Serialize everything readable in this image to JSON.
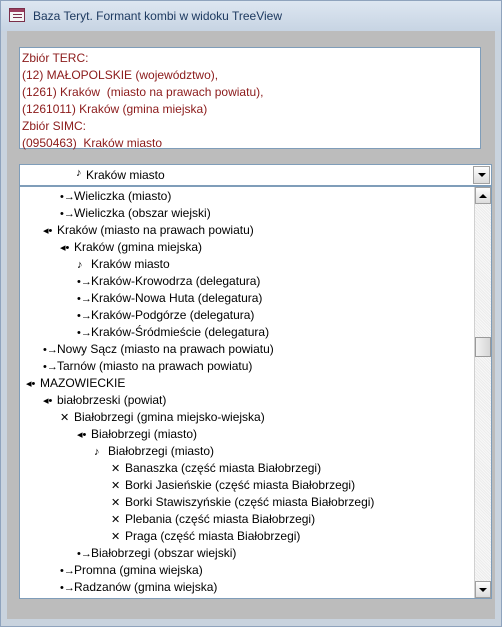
{
  "window": {
    "title": "Baza Teryt. Formant kombi w widoku TreeView"
  },
  "info": {
    "lines": [
      "Zbiór TERC:",
      "(12) MAŁOPOLSKIE (województwo),",
      "(1261) Kraków  (miasto na prawach powiatu),",
      "(1261011) Kraków (gmina miejska)",
      "Zbiór SIMC:",
      "(0950463)  Kraków miasto"
    ]
  },
  "combo": {
    "selected": "Kraków miasto"
  },
  "tree": {
    "glyphs": {
      "expanded": "◂•",
      "collapsed": "•→",
      "leaf": "✕",
      "selected": "♪"
    },
    "nodes": [
      {
        "label": "Wieliczka (miasto)",
        "glyph": "•→",
        "level": 2
      },
      {
        "label": "Wieliczka (obszar wiejski)",
        "glyph": "•→",
        "level": 2
      },
      {
        "label": "Kraków (miasto na prawach powiatu)",
        "glyph": "◂•",
        "level": 1
      },
      {
        "label": "Kraków (gmina miejska)",
        "glyph": "◂•",
        "level": 2
      },
      {
        "label": "Kraków miasto",
        "glyph": "♪",
        "level": 3
      },
      {
        "label": "Kraków-Krowodrza (delegatura)",
        "glyph": "•→",
        "level": 3
      },
      {
        "label": "Kraków-Nowa Huta (delegatura)",
        "glyph": "•→",
        "level": 3
      },
      {
        "label": "Kraków-Podgórze (delegatura)",
        "glyph": "•→",
        "level": 3
      },
      {
        "label": "Kraków-Śródmieście (delegatura)",
        "glyph": "•→",
        "level": 3
      },
      {
        "label": "Nowy Sącz (miasto na prawach powiatu)",
        "glyph": "•→",
        "level": 1
      },
      {
        "label": "Tarnów (miasto na prawach powiatu)",
        "glyph": "•→",
        "level": 1
      },
      {
        "label": "MAZOWIECKIE",
        "glyph": "◂•",
        "level": 0
      },
      {
        "label": "białobrzeski (powiat)",
        "glyph": "◂•",
        "level": 1
      },
      {
        "label": "Białobrzegi (gmina miejsko-wiejska)",
        "glyph": "✕",
        "level": 2
      },
      {
        "label": "Białobrzegi (miasto)",
        "glyph": "◂•",
        "level": 3
      },
      {
        "label": "Białobrzegi (miasto)",
        "glyph": "♪",
        "level": 4
      },
      {
        "label": "Banaszka (część miasta Białobrzegi)",
        "glyph": "✕",
        "level": 5
      },
      {
        "label": "Borki Jasieńskie (część miasta Białobrzegi)",
        "glyph": "✕",
        "level": 5
      },
      {
        "label": "Borki Stawiszyńskie (część miasta Białobrzegi)",
        "glyph": "✕",
        "level": 5
      },
      {
        "label": "Plebania (część miasta Białobrzegi)",
        "glyph": "✕",
        "level": 5
      },
      {
        "label": "Praga (część miasta Białobrzegi)",
        "glyph": "✕",
        "level": 5
      },
      {
        "label": "Białobrzegi (obszar wiejski)",
        "glyph": "•→",
        "level": 3
      },
      {
        "label": "Promna (gmina wiejska)",
        "glyph": "•→",
        "level": 2
      },
      {
        "label": "Radzanów (gmina wiejska)",
        "glyph": "•→",
        "level": 2
      }
    ]
  }
}
